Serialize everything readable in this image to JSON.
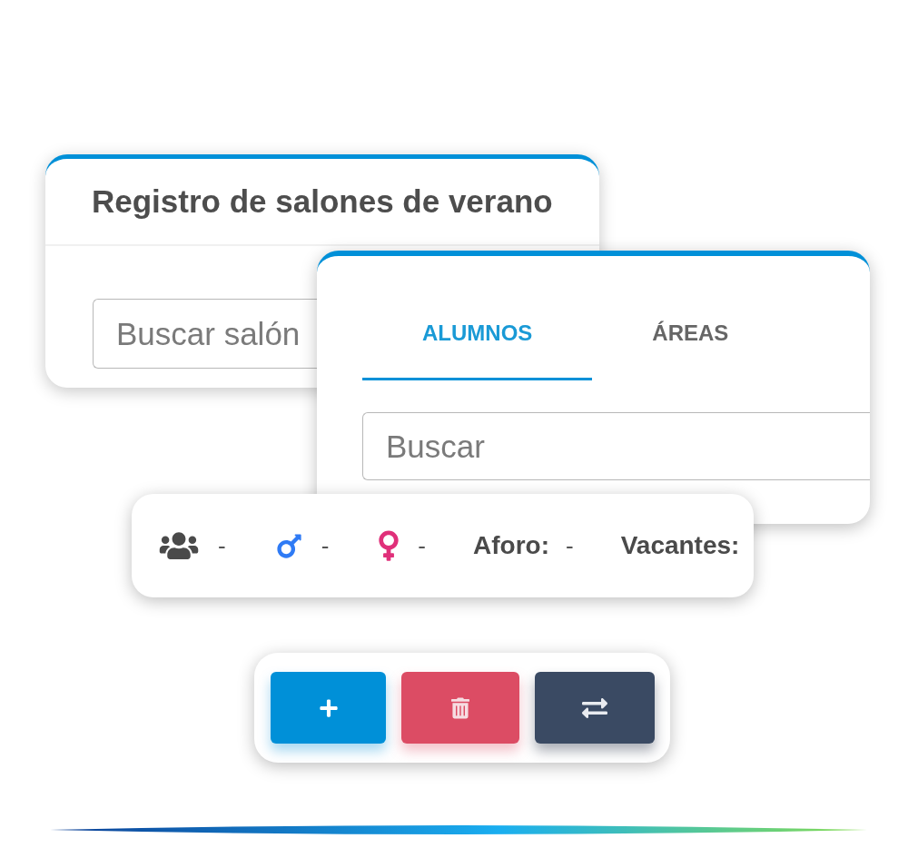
{
  "registro_card": {
    "title": "Registro de salones de verano",
    "search": {
      "placeholder": "Buscar salón"
    }
  },
  "tabs_card": {
    "tabs": [
      {
        "label": "ALUMNOS",
        "selected": true
      },
      {
        "label": "ÁREAS",
        "selected": false
      }
    ],
    "search": {
      "placeholder": "Buscar"
    }
  },
  "stats_bar": {
    "items": [
      {
        "kind": "total",
        "value": "-"
      },
      {
        "kind": "male",
        "value": "-"
      },
      {
        "kind": "female",
        "value": "-"
      },
      {
        "kind": "labeled",
        "label": "Aforo:",
        "value": "-"
      },
      {
        "kind": "labeled",
        "label": "Vacantes:"
      }
    ]
  },
  "action_buttons": [
    {
      "kind": "add"
    },
    {
      "kind": "delete"
    },
    {
      "kind": "transfer"
    }
  ]
}
